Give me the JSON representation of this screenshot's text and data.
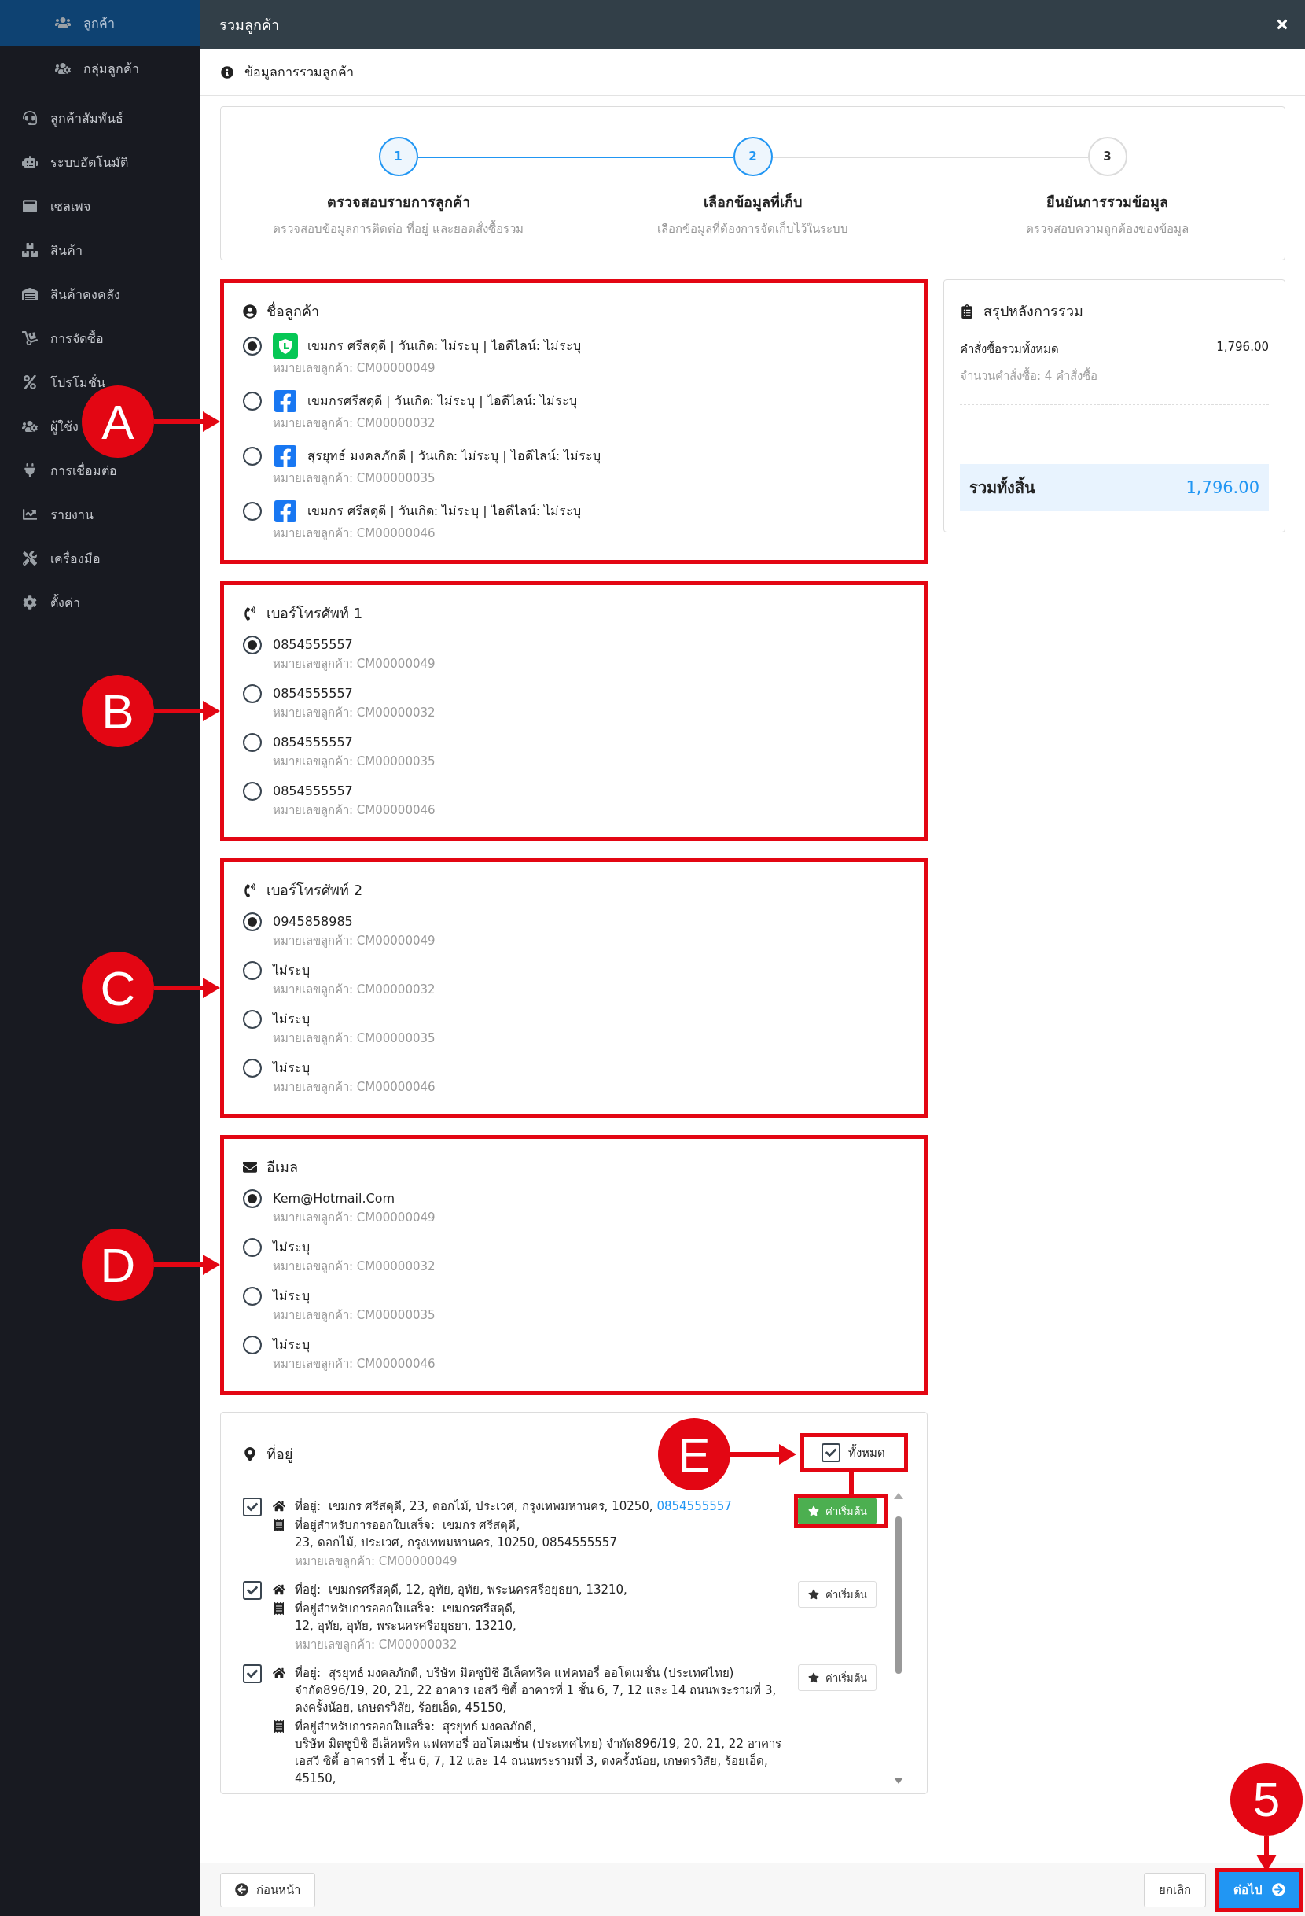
{
  "sidebar": {
    "items": [
      {
        "label": "ลูกค้า",
        "kind": "sub",
        "selected": true
      },
      {
        "label": "กลุ่มลูกค้า",
        "kind": "sub",
        "selected": false
      },
      {
        "label": "ลูกค้าสัมพันธ์",
        "kind": "main",
        "selected": false
      },
      {
        "label": "ระบบอัตโนมัติ",
        "kind": "main",
        "selected": false
      },
      {
        "label": "เซลเพจ",
        "kind": "main",
        "selected": false
      },
      {
        "label": "สินค้า",
        "kind": "main",
        "selected": false
      },
      {
        "label": "สินค้าคงคลัง",
        "kind": "main",
        "selected": false
      },
      {
        "label": "การจัดซื้อ",
        "kind": "main",
        "selected": false
      },
      {
        "label": "โปรโมชั่น",
        "kind": "main",
        "selected": false
      },
      {
        "label": "ผู้ใช้ง",
        "kind": "main",
        "selected": false
      },
      {
        "label": "การเชื่อมต่อ",
        "kind": "main",
        "selected": false
      },
      {
        "label": "รายงาน",
        "kind": "main",
        "selected": false
      },
      {
        "label": "เครื่องมือ",
        "kind": "main",
        "selected": false
      },
      {
        "label": "ตั้งค่า",
        "kind": "main",
        "selected": false
      }
    ]
  },
  "modal": {
    "title": "รวมลูกค้า"
  },
  "info_bar": "ข้อมูลการรวมลูกค้า",
  "stepper": [
    {
      "number": "1",
      "title": "ตรวจสอบรายการลูกค้า",
      "subtitle": "ตรวจสอบข้อมูลการติดต่อ ที่อยู่ และยอดสั่งซื้อรวม",
      "active": true
    },
    {
      "number": "2",
      "title": "เลือกข้อมูลที่เก็บ",
      "subtitle": "เลือกข้อมูลที่ต้องการจัดเก็บไว้ในระบบ",
      "active": true
    },
    {
      "number": "3",
      "title": "ยืนยันการรวมข้อมูล",
      "subtitle": "ตรวจสอบความถูกต้องของข้อมูล",
      "active": false
    }
  ],
  "sections": [
    {
      "kind": "name",
      "title": "ชื่อลูกค้า",
      "callout": "A",
      "options": [
        {
          "text": "เขมกร ศรีสดุดี | วันเกิด: ไม่ระบุ | ไอดีไลน์: ไม่ระบุ",
          "customer_id": "หมายเลขลูกค้า: CM00000049",
          "selected": true,
          "kind": "line"
        },
        {
          "text": "เขมกรศรีสดุดี | วันเกิด: ไม่ระบุ | ไอดีไลน์: ไม่ระบุ",
          "customer_id": "หมายเลขลูกค้า: CM00000032",
          "selected": false,
          "kind": "facebook"
        },
        {
          "text": "สุรยุทธ์ มงคลภักดี | วันเกิด: ไม่ระบุ | ไอดีไลน์: ไม่ระบุ",
          "customer_id": "หมายเลขลูกค้า: CM00000035",
          "selected": false,
          "kind": "facebook"
        },
        {
          "text": "เขมกร ศรีสดุดี | วันเกิด: ไม่ระบุ | ไอดีไลน์: ไม่ระบุ",
          "customer_id": "หมายเลขลูกค้า: CM00000046",
          "selected": false,
          "kind": "facebook"
        }
      ]
    },
    {
      "kind": "phone",
      "title": "เบอร์โทรศัพท์ 1",
      "callout": "B",
      "options": [
        {
          "text": "0854555557",
          "customer_id": "หมายเลขลูกค้า: CM00000049",
          "selected": true
        },
        {
          "text": "0854555557",
          "customer_id": "หมายเลขลูกค้า: CM00000032",
          "selected": false
        },
        {
          "text": "0854555557",
          "customer_id": "หมายเลขลูกค้า: CM00000035",
          "selected": false
        },
        {
          "text": "0854555557",
          "customer_id": "หมายเลขลูกค้า: CM00000046",
          "selected": false
        }
      ]
    },
    {
      "kind": "phone",
      "title": "เบอร์โทรศัพท์ 2",
      "callout": "C",
      "options": [
        {
          "text": "0945858985",
          "customer_id": "หมายเลขลูกค้า: CM00000049",
          "selected": true
        },
        {
          "text": "ไม่ระบุ",
          "customer_id": "หมายเลขลูกค้า: CM00000032",
          "selected": false
        },
        {
          "text": "ไม่ระบุ",
          "customer_id": "หมายเลขลูกค้า: CM00000035",
          "selected": false
        },
        {
          "text": "ไม่ระบุ",
          "customer_id": "หมายเลขลูกค้า: CM00000046",
          "selected": false
        }
      ]
    },
    {
      "kind": "email",
      "title": "อีเมล",
      "callout": "D",
      "options": [
        {
          "text": "Kem@Hotmail.Com",
          "customer_id": "หมายเลขลูกค้า: CM00000049",
          "selected": true
        },
        {
          "text": "ไม่ระบุ",
          "customer_id": "หมายเลขลูกค้า: CM00000032",
          "selected": false
        },
        {
          "text": "ไม่ระบุ",
          "customer_id": "หมายเลขลูกค้า: CM00000035",
          "selected": false
        },
        {
          "text": "ไม่ระบุ",
          "customer_id": "หมายเลขลูกค้า: CM00000046",
          "selected": false
        }
      ]
    }
  ],
  "address": {
    "title": "ที่อยู่",
    "select_all": {
      "label": "ทั้งหมด",
      "checked": true,
      "callout": "E"
    },
    "items": [
      {
        "checked": true,
        "address_label": "ที่อยู่:",
        "address": "เขมกร ศรีสดุดี, 23, ดอกไม้, ประเวศ, กรุงเทพมหานคร, 10250,",
        "phone": "0854555557",
        "billing_label": "ที่อยู่สำหรับการออกใบเสร็จ:",
        "billing_name": "เขมกร ศรีสดุดี,",
        "billing_address": "23, ดอกไม้, ประเวศ, กรุงเทพมหานคร, 10250, 0854555557",
        "customer_id": "หมายเลขลูกค้า: CM00000049",
        "default_label": "ค่าเริ่มต้น",
        "default": true,
        "highlighted": true
      },
      {
        "checked": true,
        "address_label": "ที่อยู่:",
        "address": "เขมกรศรีสดุดี, 12, อุทัย, อุทัย, พระนครศรีอยุธยา, 13210,",
        "billing_label": "ที่อยู่สำหรับการออกใบเสร็จ:",
        "billing_name": "เขมกรศรีสดุดี,",
        "billing_address": "12, อุทัย, อุทัย, พระนครศรีอยุธยา, 13210,",
        "customer_id": "หมายเลขลูกค้า: CM00000032",
        "default_label": "ค่าเริ่มต้น",
        "default": false,
        "highlighted": false
      },
      {
        "checked": true,
        "address_label": "ที่อยู่:",
        "address": "สุรยุทธ์ มงคลภักดี, บริษัท มิตซูบิชิ อีเล็คทริค แฟคทอรี่ ออโตเมชั่น (ประเทศไทย) จำกัด896/19, 20, 21, 22 อาคาร เอสวี ซิตี้ อาคารที่ 1 ชั้น 6, 7, 12 และ 14 ถนนพระรามที่ 3, ดงครั้งน้อย, เกษตรวิสัย, ร้อยเอ็ด, 45150,",
        "billing_label": "ที่อยู่สำหรับการออกใบเสร็จ:",
        "billing_name": "สุรยุทธ์ มงคลภักดี,",
        "billing_address": "บริษัท มิตซูบิชิ อีเล็คทริค แฟคทอรี่ ออโตเมชั่น (ประเทศไทย) จำกัด896/19, 20, 21, 22 อาคาร เอสวี ซิตี้ อาคารที่ 1 ชั้น 6, 7, 12 และ 14 ถนนพระรามที่ 3, ดงครั้งน้อย, เกษตรวิสัย, ร้อยเอ็ด, 45150,",
        "default_label": "ค่าเริ่มต้น",
        "default": false,
        "highlighted": false
      }
    ]
  },
  "summary": {
    "title": "สรุปหลังการรวม",
    "row_label": "คำสั่งซื้อรวมทั้งหมด",
    "row_value": "1,796.00",
    "row_note": "จำนวนคำสั่งซื้อ: 4 คำสั่งซื้อ",
    "total_label": "รวมทั้งสิ้น",
    "total_value": "1,796.00"
  },
  "footer": {
    "back": "ก่อนหน้า",
    "cancel": "ยกเลิก",
    "next": "ต่อไป",
    "next_callout": "5"
  }
}
